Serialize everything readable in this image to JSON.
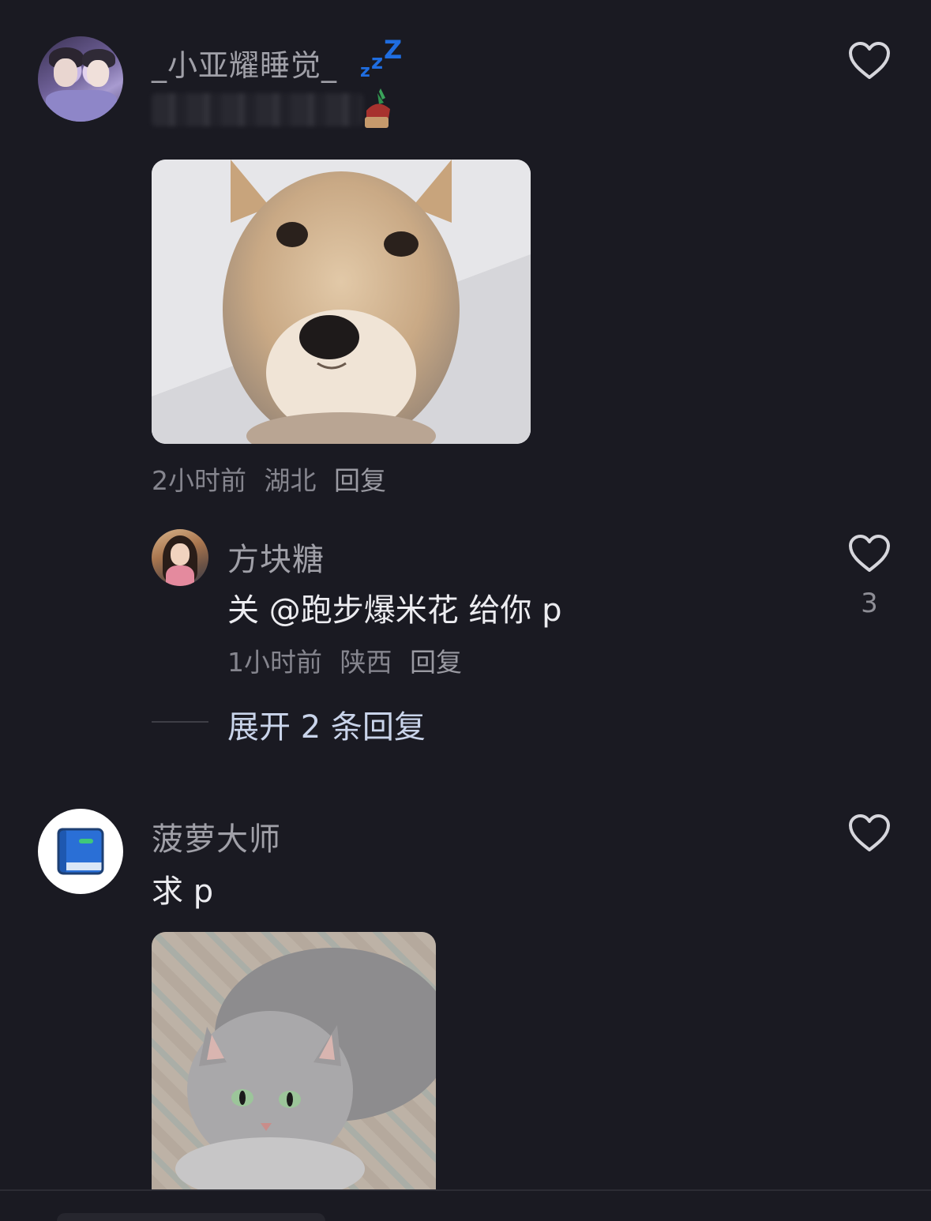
{
  "comments": [
    {
      "username": "_小亚耀睡觉_",
      "username_suffix_icon": "zzz-sleep-emoji",
      "text_emoji": "leek-emoji",
      "image": "shiba-puppy-photo",
      "meta": {
        "time": "2小时前",
        "location": "湖北",
        "reply_label": "回复"
      },
      "reply_thread": {
        "replies": [
          {
            "username": "方块糖",
            "text": "关 @跑步爆米花 给你 p",
            "meta": {
              "time": "1小时前",
              "location": "陕西",
              "reply_label": "回复"
            },
            "like_count": "3"
          }
        ],
        "expand_label": "展开 2 条回复"
      }
    },
    {
      "username": "菠萝大师",
      "avatar_icon": "blue-book-icon",
      "text": "求 p",
      "image": "grey-cat-photo"
    }
  ],
  "icons": {
    "like": "heart-outline-icon",
    "zzz": "zzz-icon"
  },
  "colors": {
    "background": "#1a1a22",
    "zzz_blue": "#1f6de0",
    "expand_link": "#c9d4ea"
  }
}
